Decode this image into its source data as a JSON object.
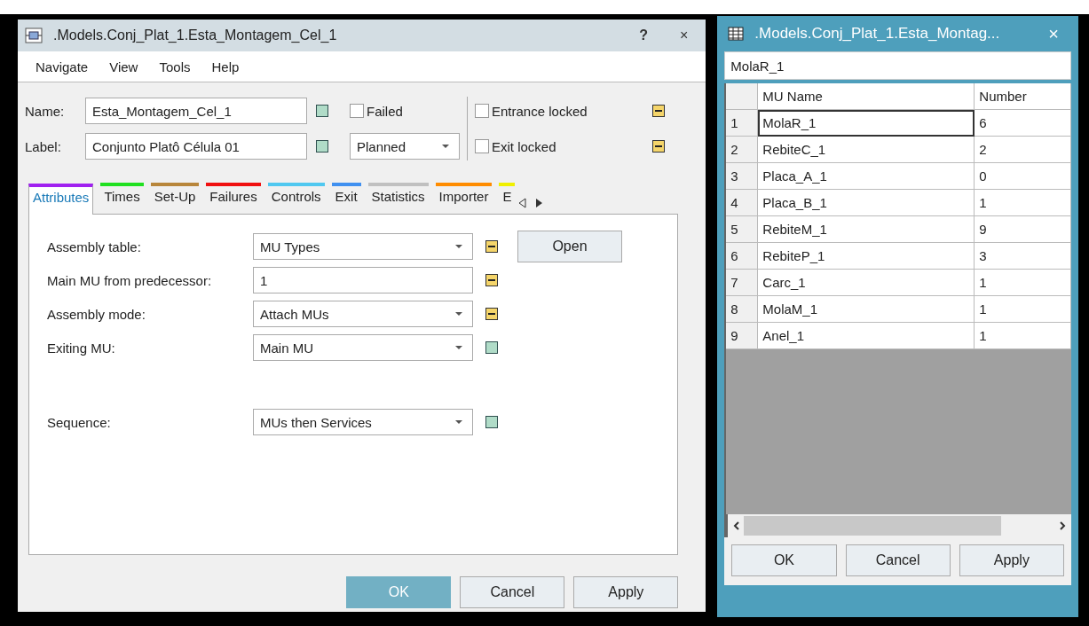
{
  "main_window": {
    "title": ".Models.Conj_Plat_1.Esta_Montagem_Cel_1",
    "help": "?",
    "close": "×",
    "menu": [
      "Navigate",
      "View",
      "Tools",
      "Help"
    ],
    "name": {
      "label": "Name:",
      "value": "Esta_Montagem_Cel_1",
      "inherited": true
    },
    "label": {
      "label": "Label:",
      "value": "Conjunto Platô Célula 01",
      "inherited": true
    },
    "failed": {
      "label": "Failed",
      "checked": false
    },
    "state": {
      "value": "Planned"
    },
    "entrance_locked": {
      "label": "Entrance locked",
      "checked": false,
      "inherited": false
    },
    "exit_locked": {
      "label": "Exit locked",
      "checked": false,
      "inherited": false
    },
    "tabs": [
      {
        "label": "Attributes",
        "color": "#a020f0",
        "selected": true
      },
      {
        "label": "Times",
        "color": "#20e020",
        "selected": false
      },
      {
        "label": "Set-Up",
        "color": "#b8863b",
        "selected": false
      },
      {
        "label": "Failures",
        "color": "#f01010",
        "selected": false
      },
      {
        "label": "Controls",
        "color": "#50c8f0",
        "selected": false
      },
      {
        "label": "Exit",
        "color": "#4090f0",
        "selected": false
      },
      {
        "label": "Statistics",
        "color": "#c0c0c0",
        "selected": false
      },
      {
        "label": "Importer",
        "color": "#ff8c00",
        "selected": false
      },
      {
        "label": "E",
        "color": "#f0f000",
        "selected": false
      }
    ],
    "fields": [
      {
        "label": "Assembly table:",
        "kind": "dropdown",
        "value": "MU Types",
        "inherited": false,
        "button": "Open"
      },
      {
        "label": "Main MU from predecessor:",
        "kind": "input",
        "value": "1",
        "inherited": false
      },
      {
        "label": "Assembly mode:",
        "kind": "dropdown",
        "value": "Attach MUs",
        "inherited": false
      },
      {
        "label": "Exiting MU:",
        "kind": "dropdown",
        "value": "Main MU",
        "inherited": true
      },
      {
        "label": "Sequence:",
        "kind": "dropdown",
        "value": "MUs then Services",
        "inherited": true
      }
    ],
    "buttons": [
      {
        "label": "OK",
        "kind": "primary"
      },
      {
        "label": "Cancel",
        "kind": "normal"
      },
      {
        "label": "Apply",
        "kind": "normal"
      }
    ]
  },
  "table_window": {
    "title": ".Models.Conj_Plat_1.Esta_Montag...",
    "close": "×",
    "cell_value": "MolaR_1",
    "columns": [
      "MU Name",
      "Number"
    ],
    "rows": [
      {
        "index": "1",
        "name": "MolaR_1",
        "number": "6",
        "selected": true
      },
      {
        "index": "2",
        "name": "RebiteC_1",
        "number": "2",
        "selected": false
      },
      {
        "index": "3",
        "name": "Placa_A_1",
        "number": "0",
        "selected": false
      },
      {
        "index": "4",
        "name": "Placa_B_1",
        "number": "1",
        "selected": false
      },
      {
        "index": "5",
        "name": "RebiteM_1",
        "number": "9",
        "selected": false
      },
      {
        "index": "6",
        "name": "RebiteP_1",
        "number": "3",
        "selected": false
      },
      {
        "index": "7",
        "name": "Carc_1",
        "number": "1",
        "selected": false
      },
      {
        "index": "8",
        "name": "MolaM_1",
        "number": "1",
        "selected": false
      },
      {
        "index": "9",
        "name": "Anel_1",
        "number": "1",
        "selected": false
      }
    ],
    "buttons": [
      "OK",
      "Cancel",
      "Apply"
    ]
  }
}
